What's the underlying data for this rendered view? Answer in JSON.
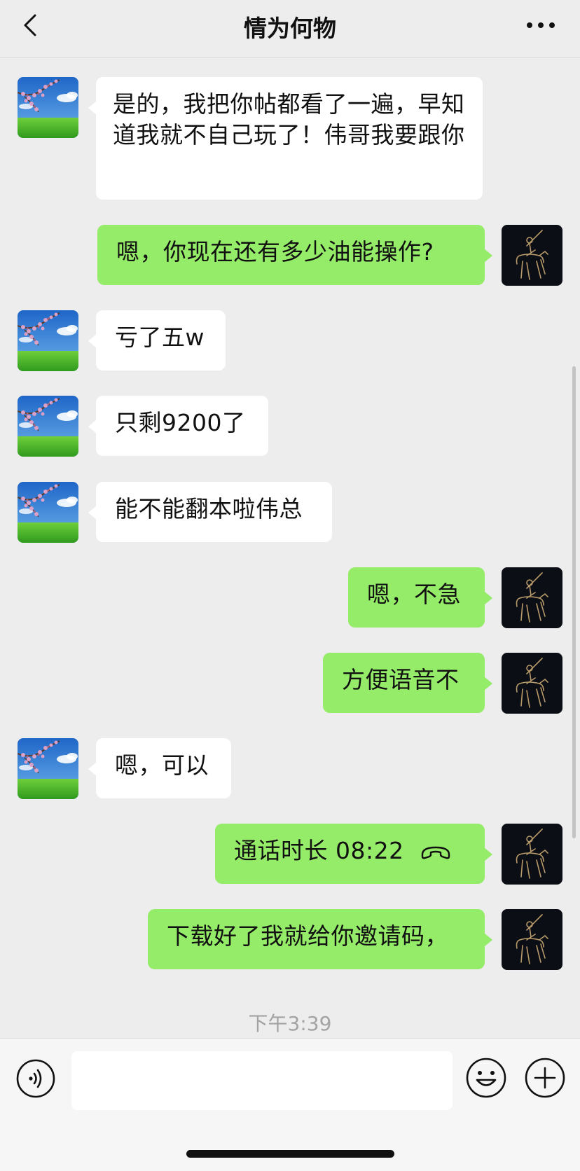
{
  "header": {
    "title": "情为何物"
  },
  "messages": [
    {
      "side": "in",
      "text": "是的，我把你帖都看了一遍，早知道我就不自己玩了！伟哥我要跟你"
    },
    {
      "side": "out",
      "text": "嗯，你现在还有多少油能操作?"
    },
    {
      "side": "in",
      "text": "亏了五w"
    },
    {
      "side": "in",
      "text": "只剩9200了"
    },
    {
      "side": "in",
      "text": "能不能翻本啦伟总"
    },
    {
      "side": "out",
      "text": "嗯，不急"
    },
    {
      "side": "out",
      "text": "方便语音不"
    },
    {
      "side": "in",
      "text": "嗯，可以"
    },
    {
      "side": "out",
      "text": "通话时长 08:22",
      "icon": "phone-hangup-icon"
    },
    {
      "side": "out",
      "text": "下载好了我就给你邀请码，"
    }
  ],
  "timestamp": "下午3:39",
  "input": {
    "value": "",
    "placeholder": ""
  },
  "icons": {
    "back": "chevron-left-icon",
    "more": "more-dots-icon",
    "voice": "voice-icon",
    "emoji": "emoji-icon",
    "plus": "plus-icon"
  },
  "colors": {
    "background": "#ededed",
    "outgoing_bubble": "#95ec69",
    "incoming_bubble": "#ffffff",
    "timestamp": "#a3a3a3"
  }
}
